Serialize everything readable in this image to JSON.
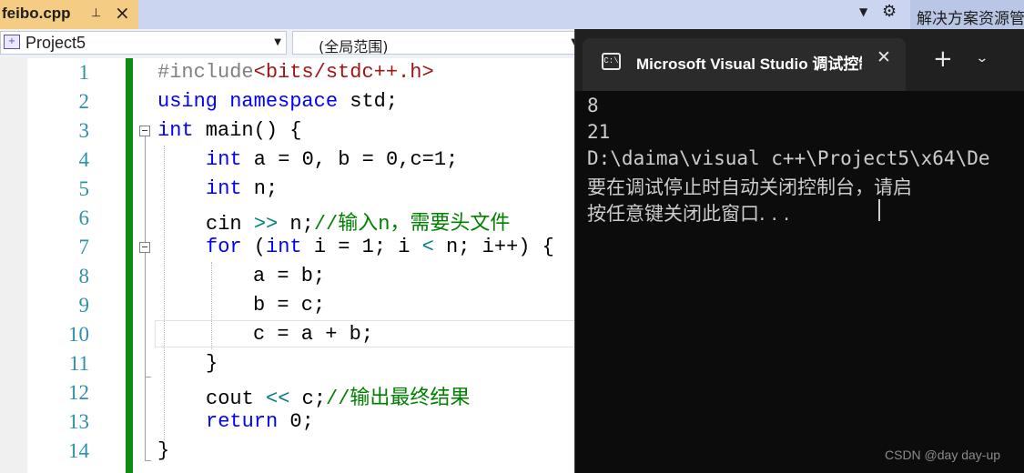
{
  "file_tab": {
    "title": "feibo.cpp",
    "pin_icon": "pin-icon",
    "close_icon": "close-icon"
  },
  "toolbar": {
    "dropdown_icon": "chevron-down-icon",
    "settings_icon": "gear-icon",
    "solution_explorer_label": "解决方案资源管"
  },
  "navbar": {
    "project": "Project5",
    "scope": "(全局范围)"
  },
  "editor": {
    "line_numbers": [
      "1",
      "2",
      "3",
      "4",
      "5",
      "6",
      "7",
      "8",
      "9",
      "10",
      "11",
      "12",
      "13",
      "14"
    ],
    "colors": {
      "keyword": "#0000ff",
      "comment": "#008000",
      "include": "#a31515",
      "line_number": "#2b91af",
      "change_bar": "#108a10"
    },
    "tokens": {
      "l1_directive": "#include",
      "l1_header": "<bits/stdc++.h>",
      "l2_using": "using",
      "l2_namespace": "namespace",
      "l2_rest": " std;",
      "l3_int": "int",
      "l3_rest": " main() {",
      "l4_int": "int",
      "l4_rest": " a = 0, b = 0,c=1;",
      "l5_int": "int",
      "l5_rest": " n;",
      "l6_cin": "cin ",
      "l6_op": ">>",
      "l6_var": " n;",
      "l6_comment": "//输入n，需要头文件",
      "l7_for": "for",
      "l7_open": " (",
      "l7_int": "int",
      "l7_mid": " i = 1; i ",
      "l7_lt": "<",
      "l7_end": " n; i++) {",
      "l8": "a = b;",
      "l9": "b = c;",
      "l10": "c = a + b;",
      "l11": "}",
      "l12_cout": "cout ",
      "l12_op": "<<",
      "l12_var": " c;",
      "l12_comment": "//输出最终结果",
      "l13_return": "return",
      "l13_rest": " 0;",
      "l14": "}"
    }
  },
  "console": {
    "title": "Microsoft Visual Studio 调试控制台",
    "icon": "console-icon",
    "close_icon": "close-icon",
    "new_tab_icon": "plus-icon",
    "menu_icon": "chevron-down-icon",
    "output": [
      "8",
      "21",
      "D:\\daima\\visual c++\\Project5\\x64\\De",
      "要在调试停止时自动关闭控制台，请启",
      "按任意键关闭此窗口. . ."
    ]
  },
  "watermark": "CSDN @day day-up"
}
